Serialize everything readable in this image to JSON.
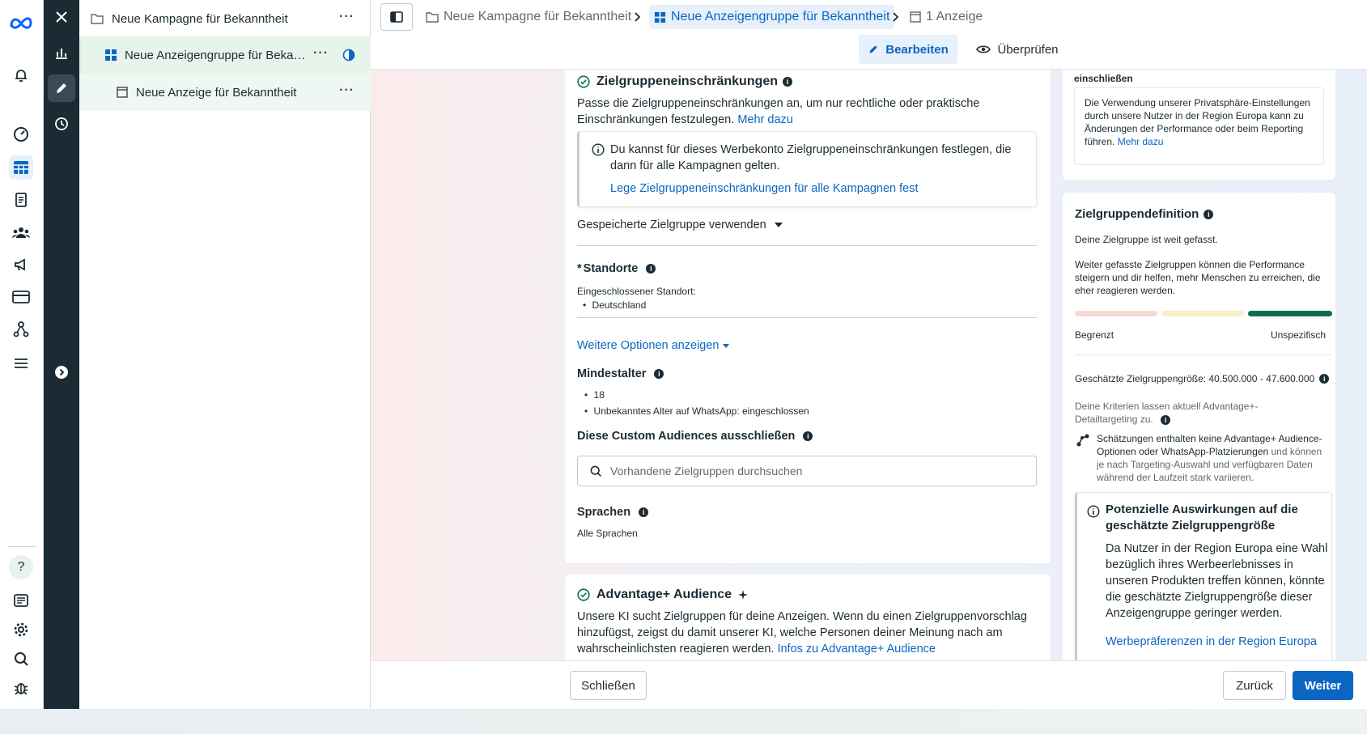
{
  "tree": {
    "campaign": "Neue Kampagne für Bekanntheit",
    "adset": "Neue Anzeigengruppe für Beka…",
    "ad": "Neue Anzeige für Bekanntheit"
  },
  "breadcrumbs": {
    "campaign": "Neue Kampagne für Bekanntheit",
    "adset": "Neue Anzeigengruppe für Bekanntheit",
    "ads": "1 Anzeige"
  },
  "modes": {
    "edit": "Bearbeiten",
    "review": "Überprüfen"
  },
  "restrictions": {
    "title": "Zielgruppeneinschränkungen",
    "desc": "Passe die Zielgruppeneinschränkungen an, um nur rechtliche oder praktische Einschränkungen festzulegen.",
    "more": "Mehr dazu",
    "note": "Du kannst für dieses Werbekonto Zielgruppeneinschränkungen festlegen, die dann für alle Kampagnen gelten.",
    "note_link": "Lege Zielgruppeneinschränkungen für alle Kampagnen fest",
    "saved": "Gespeicherte Zielgruppe verwenden",
    "locations_title": "Standorte",
    "locations_label": "Eingeschlossener Standort:",
    "location": "Deutschland",
    "more_options": "Weitere Optionen anzeigen",
    "min_age_title": "Mindestalter",
    "min_age": "18",
    "unknown_age": "Unbekanntes Alter auf WhatsApp: eingeschlossen",
    "exclude_title": "Diese Custom Audiences ausschließen",
    "search_placeholder": "Vorhandene Zielgruppen durchsuchen",
    "languages_title": "Sprachen",
    "languages": "Alle Sprachen"
  },
  "advantage": {
    "title": "Advantage+ Audience",
    "desc": "Unsere KI sucht Zielgruppen für deine Anzeigen. Wenn du einen Zielgruppenvorschlag hinzufügst, zeigst du damit unserer KI, welche Personen deiner Meinung nach am wahrscheinlichsten reagieren werden.",
    "link": "Infos zu Advantage+ Audience"
  },
  "right_top": {
    "title": "einschließen",
    "text": "Die Verwendung unserer Privatsphäre-Einstellungen durch unsere Nutzer in der Region Europa kann zu Änderungen der Performance oder beim Reporting führen.",
    "link": "Mehr dazu"
  },
  "definition": {
    "title": "Zielgruppendefinition",
    "broad": "Deine Zielgruppe ist weit gefasst.",
    "desc": "Weiter gefasste Zielgruppen können die Performance steigern und dir helfen, mehr Menschen zu erreichen, die eher reagieren werden.",
    "left": "Begrenzt",
    "right": "Unspezifisch",
    "size": "Geschätzte Zielgruppengröße: 40.500.000 - 47.600.000",
    "criteria": "Deine Kriterien lassen aktuell Advantage+-Detailtargeting zu.",
    "estimate_bold": "Schätzungen enthalten keine Advantage+ Audience-Optionen oder WhatsApp-Platzierungen",
    "estimate_rest": "und können je nach Targeting-Auswahl und verfügbaren Daten während der Laufzeit stark variieren.",
    "impact_title": "Potenzielle Auswirkungen auf die geschätzte Zielgruppengröße",
    "impact_text": "Da Nutzer in der Region Europa eine Wahl bezüglich ihres Werbeerlebnisses in unseren Produkten treffen können, könnte die geschätzte Zielgruppengröße dieser Anzeigengruppe geringer werden.",
    "impact_link": "Werbepräferenzen in der Region Europa",
    "colors": {
      "limited": "#f8d7d7",
      "mid": "#f6efc9",
      "broad": "#0b6e4f"
    }
  },
  "footer": {
    "close": "Schließen",
    "back": "Zurück",
    "next": "Weiter"
  }
}
